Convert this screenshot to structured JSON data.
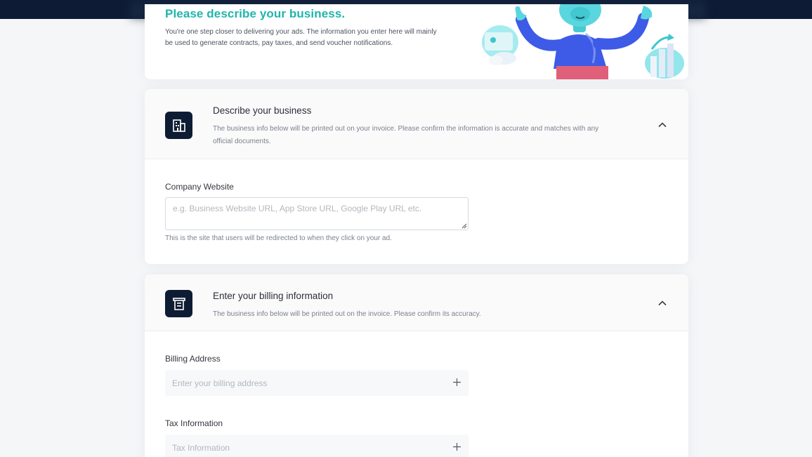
{
  "hero": {
    "title": "Please describe your business.",
    "description": "You're one step closer to delivering your ads. The information you enter here will mainly be used to generate contracts, pay taxes, and send voucher notifications."
  },
  "business_section": {
    "title": "Describe your business",
    "description": "The business info below will be printed out on your invoice. Please confirm the information is accurate and matches with any official documents.",
    "icon": "building-icon",
    "website_label": "Company Website",
    "website_placeholder": "e.g. Business Website URL, App Store URL, Google Play URL etc.",
    "website_help": "This is the site that users will be redirected to when they click on your ad."
  },
  "billing_section": {
    "title": "Enter your billing information",
    "description": "The business info below will be printed out on the invoice. Please confirm its accuracy.",
    "icon": "receipt-icon",
    "address_label": "Billing Address",
    "address_placeholder": "Enter your billing address",
    "tax_label": "Tax Information",
    "tax_placeholder": "Tax Information"
  },
  "colors": {
    "accent": "#1fb5ad",
    "topbar": "#0d1b35",
    "icon_bg": "#0e1c33"
  }
}
